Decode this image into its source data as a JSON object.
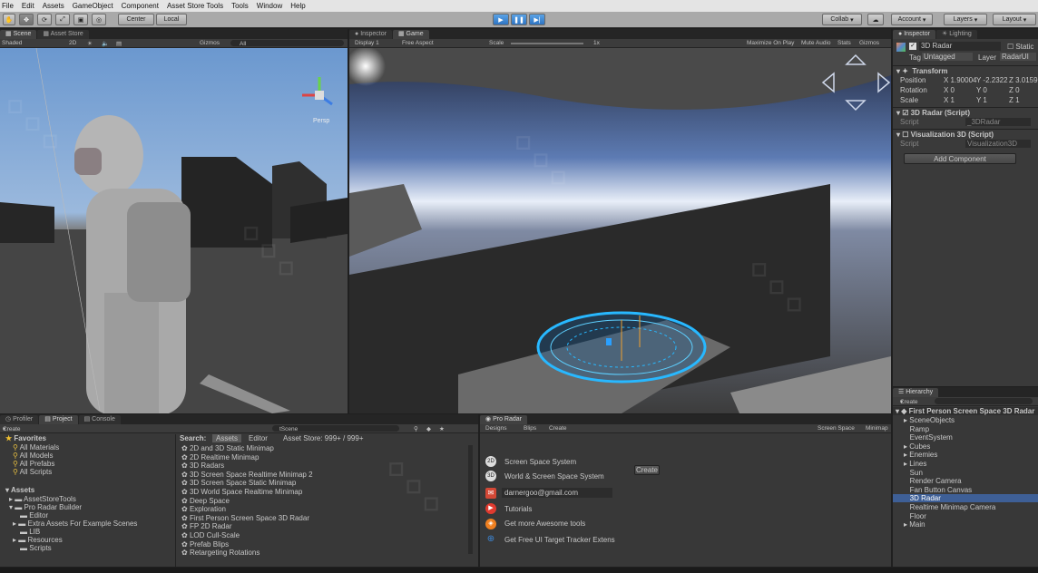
{
  "menu": [
    "File",
    "Edit",
    "Assets",
    "GameObject",
    "Component",
    "Asset Store Tools",
    "Tools",
    "Window",
    "Help"
  ],
  "toolbar": {
    "center": "Center",
    "local": "Local",
    "collab": "Collab",
    "account": "Account",
    "layers": "Layers",
    "layout": "Layout"
  },
  "scene": {
    "tab1": "Scene",
    "tab2": "Asset Store",
    "shading": "Shaded",
    "mode2d": "2D",
    "gizmos": "Gizmos",
    "search": "All",
    "persp": "Persp"
  },
  "game": {
    "tab": "Game",
    "display": "Display 1",
    "aspect": "Free Aspect",
    "scale": "Scale",
    "scale_val": "1x",
    "maximize": "Maximize On Play",
    "mute": "Mute Audio",
    "stats": "Stats",
    "gizmos": "Gizmos"
  },
  "inspector": {
    "tab1": "Inspector",
    "tab2": "Lighting",
    "obj_name": "3D Radar",
    "static": "Static",
    "tag_label": "Tag",
    "tag_value": "Untagged",
    "layer_label": "Layer",
    "layer_value": "RadarUI",
    "transform": "Transform",
    "position": "Position",
    "rotation": "Rotation",
    "scale": "Scale",
    "pos": [
      "X 1.90004",
      "Y -2.2322",
      "Z 3.01599"
    ],
    "rot": [
      "X 0",
      "Y 0",
      "Z 0"
    ],
    "scl": [
      "X 1",
      "Y 1",
      "Z 1"
    ],
    "radar_script": "3D Radar (Script)",
    "script_label": "Script",
    "radar_script_file": "_3DRadar",
    "vis_script": "Visualization 3D (Script)",
    "vis_script_file": "Visualization3D",
    "add_component": "Add Component"
  },
  "project": {
    "tab1": "Profiler",
    "tab2": "Project",
    "tab3": "Console",
    "create": "Create",
    "favorites": "Favorites",
    "fav_items": [
      "All Materials",
      "All Models",
      "All Prefabs",
      "All Scripts"
    ],
    "assets": "Assets",
    "asset_items": [
      "AssetStoreTools",
      "Pro Radar Builder",
      "Editor",
      "Extra Assets For Example Scenes",
      "LIB",
      "Resources",
      "Scripts"
    ],
    "search_label": "Search:",
    "search_tab1": "Assets",
    "search_tab2": "Editor",
    "search_store": "Asset Store: 999+ / 999+",
    "search_field": "tScene",
    "results": [
      "2D and 3D Static Minimap",
      "2D Realtime Minimap",
      "3D Radars",
      "3D Screen Space Realtime Minimap 2",
      "3D Screen Space Static Minimap",
      "3D World Space Realtime Minimap",
      "Deep Space",
      "Exploration",
      "First Person Screen Space 3D Radar",
      "FP 2D Radar",
      "LOD  Cull-Scale",
      "Prefab Blips",
      "Retargeting Rotations"
    ]
  },
  "proradar": {
    "tab": "Pro Radar",
    "tabs": [
      "Designs",
      "Blips",
      "Create"
    ],
    "right_tabs": [
      "Screen Space",
      "Minimap"
    ],
    "items": [
      "Screen Space System",
      "World & Screen Space System"
    ],
    "create_btn": "Create",
    "email": "darnergoo@gmail.com",
    "links": [
      "Tutorials",
      "Get more Awesome tools",
      "Get Free UI Target Tracker Extens"
    ]
  },
  "hierarchy": {
    "tab": "Hierarchy",
    "create": "Create",
    "scene": "First Person Screen Space 3D Radar",
    "items": [
      "SceneObjects",
      "Ramp",
      "EventSystem",
      "Cubes",
      "Enemies",
      "Lines",
      "Sun",
      "Render Camera",
      "Fan Button Canvas",
      "3D Radar",
      "Realtime Minimap Camera",
      "Floor",
      "Main"
    ],
    "selected": "3D Radar"
  },
  "colors": {
    "accent": "#3d87d6",
    "selection": "#3e5f96",
    "panel": "#383838",
    "radar": "#28b8ff"
  }
}
